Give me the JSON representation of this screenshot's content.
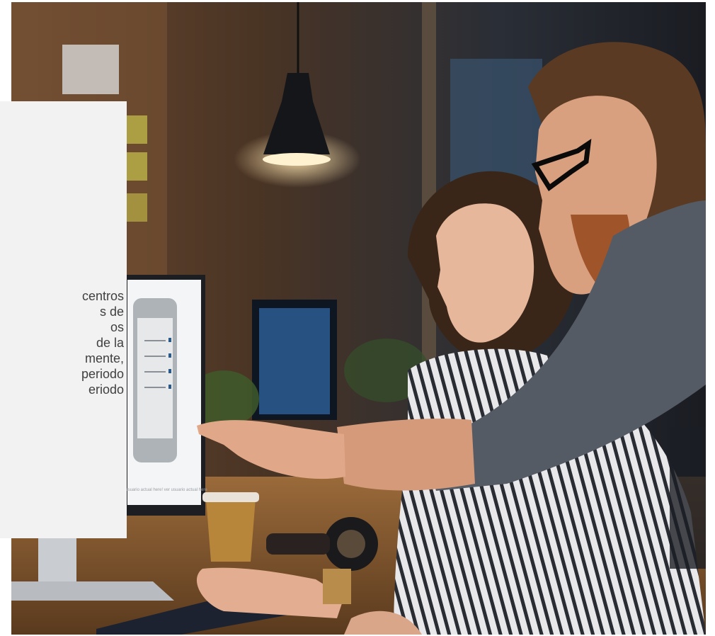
{
  "panel": {
    "text_lines": [
      "centros",
      "s de",
      "os",
      " de la",
      "mente,",
      "periodo",
      "eriodo"
    ]
  },
  "photo": {
    "screen_caption": "ver usuario actual here! ver usuario actual here"
  },
  "colors": {
    "panel_background": "#f2f2f2",
    "panel_text": "#404040",
    "photo_dark": "#1c1410",
    "photo_warm": "#8a5a2e"
  }
}
